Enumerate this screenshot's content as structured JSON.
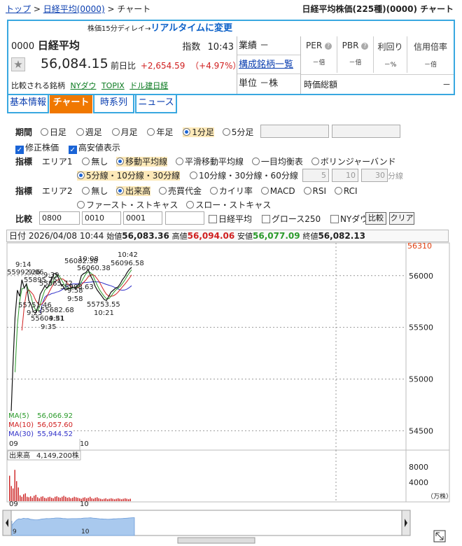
{
  "breadcrumb": [
    "トップ",
    "日経平均(0000)",
    "チャート"
  ],
  "page_heading": "日経平均株価(225種)(0000) チャート",
  "info": {
    "delay_note": "株価15分ディレイ→",
    "realtime_link": "リアルタイムに変更",
    "code": "0000",
    "name": "日経平均",
    "type": "指数",
    "time": "10:43",
    "price": "56,084.15",
    "prev_label": "前日比",
    "change": "+2,654.59",
    "change_pct": "（+4.97%）",
    "compare_label": "比較される銘柄",
    "compare_items": [
      "NYダウ",
      "TOPIX",
      "ドル建日経"
    ],
    "results_label": "業績",
    "results_value": "－",
    "constituents_link": "構成銘柄一覧",
    "unit_label": "単位",
    "unit_value": "－株",
    "ratios": [
      {
        "label": "PER",
        "value": "－倍"
      },
      {
        "label": "PBR",
        "value": "－倍"
      },
      {
        "label": "利回り",
        "value": "－%"
      },
      {
        "label": "信用倍率",
        "value": "－倍"
      }
    ],
    "mcap_label": "時価総額",
    "mcap_value": "－"
  },
  "tabs": [
    "基本情報",
    "チャート",
    "時系列",
    "ニュース"
  ],
  "controls": {
    "period_label": "期間",
    "periods": [
      "日足",
      "週足",
      "月足",
      "年足",
      "1分足",
      "5分足"
    ],
    "period_selected": "1分足",
    "adjusted_label": "修正株価",
    "highlow_label": "高安値表示",
    "indicator_label": "指標",
    "area1_label": "エリア1",
    "area1_options": [
      "無し",
      "移動平均線",
      "平滑移動平均線",
      "一目均衡表",
      "ボリンジャーバンド"
    ],
    "area1_selected": "移動平均線",
    "ma_option1": "5分線・10分線・30分線",
    "ma_option2": "10分線・30分線・60分線",
    "custom_ma": [
      "5",
      "10",
      "30"
    ],
    "custom_ma_unit": "分線",
    "area2_label": "エリア2",
    "area2_options": [
      "無し",
      "出来高",
      "売買代金",
      "カイリ率",
      "MACD",
      "RSI",
      "RCI"
    ],
    "area2_options_row2": [
      "ファースト・ストキャス",
      "スロー・ストキャス"
    ],
    "area2_selected": "出来高",
    "compare_label": "比較",
    "compare_inputs": [
      "0800",
      "0010",
      "0001",
      ""
    ],
    "compare_checks": [
      "日経平均",
      "グロース250",
      "NYダウ"
    ],
    "compare_button": "比較",
    "clear_button": "クリア"
  },
  "quote_header": {
    "date_label": "日付",
    "datetime": "2026/04/08 10:44",
    "open_label": "始値",
    "open": "56,083.36",
    "high_label": "高値",
    "high": "56,094.06",
    "low_label": "安値",
    "low": "56,077.09",
    "close_label": "終値",
    "close": "56,082.13"
  },
  "chart_data": {
    "type": "line",
    "price_axis": {
      "ticks": [
        54500,
        55000,
        55500,
        56000
      ],
      "top_label": "56310",
      "ylim": [
        54320,
        56310
      ]
    },
    "time_axis": {
      "ticks": [
        "09",
        "10"
      ]
    },
    "series_close": [
      54500,
      55100,
      55600,
      55860,
      55800,
      55960,
      55880,
      55920,
      55760,
      55720,
      55650,
      55640,
      55700,
      55820,
      55860,
      55900,
      55880,
      55920,
      55960,
      56020,
      56020,
      55980,
      55920,
      55900,
      55860,
      55870,
      55880,
      55890,
      55880,
      55900,
      55920,
      56000,
      56020,
      56030,
      56060,
      56000,
      55960,
      55900,
      55860,
      55830,
      55800,
      55770,
      55760,
      55800,
      55840,
      55860,
      55880,
      55890,
      55920,
      55960,
      55990,
      56030,
      56060,
      56080
    ],
    "ma_legend": [
      {
        "name": "MA(5)",
        "value": "56,066.92",
        "color": "#2a9a2a"
      },
      {
        "name": "MA(10)",
        "value": "56,057.60",
        "color": "#d02020"
      },
      {
        "name": "MA(30)",
        "value": "55,944.52",
        "color": "#3030c8"
      }
    ],
    "annotations": [
      "9:14",
      "55992.26",
      "9:06",
      "9:39",
      "55895.75",
      "55865.72",
      "9:58",
      "56082.38",
      "56060.38",
      "10:08",
      "55908.63",
      "9:58",
      "10:42",
      "56096.58",
      "55751.46",
      "9:25",
      "55682.68",
      "55604.51",
      "9:35",
      "9:41",
      "55753.55",
      "10:21"
    ],
    "volume": {
      "label": "出来高",
      "value": "4,149,200株",
      "ticks": [
        "8000",
        "4000"
      ],
      "unit": "（万株）",
      "ylim": [
        0,
        10000
      ]
    },
    "volume_values": [
      5200,
      3100,
      2600,
      6400,
      4100,
      2800,
      1200,
      900,
      1400,
      1600,
      900,
      800,
      1000,
      700,
      1100,
      1300,
      800,
      600,
      900,
      1000,
      700,
      600,
      800,
      900,
      700,
      600,
      900,
      1000,
      800,
      700,
      900,
      1100,
      900,
      700,
      800,
      600,
      700,
      900,
      800,
      700,
      600,
      500,
      700,
      800,
      600,
      700,
      900,
      600,
      500,
      700,
      800,
      600,
      500,
      400,
      500,
      600,
      400,
      500,
      600,
      500,
      400,
      500,
      600,
      500,
      400,
      500,
      600,
      500,
      400,
      500
    ]
  },
  "navigator_ticks": [
    "9",
    "10"
  ],
  "colors": {
    "accent": "#39a8e0",
    "tab_active": "#f07800",
    "up": "#d02020",
    "down": "#2a9a2a"
  }
}
